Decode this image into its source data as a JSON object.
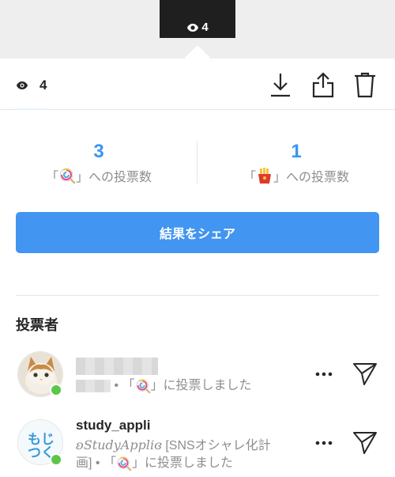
{
  "story_preview": {
    "view_count": "4"
  },
  "toolbar": {
    "view_count": "4",
    "icons": [
      "eye-icon",
      "download-icon",
      "share-icon",
      "trash-icon"
    ]
  },
  "poll_results": {
    "options": [
      {
        "emoji": "lollipop-emoji",
        "count": "3",
        "label_prefix": "「",
        "label_suffix": "」への投票数"
      },
      {
        "emoji": "fries-emoji",
        "count": "1",
        "label_prefix": "「",
        "label_suffix": "」への投票数"
      }
    ]
  },
  "share_button": {
    "label": "結果をシェア",
    "color": "#4295f0"
  },
  "voters_section": {
    "title": "投票者",
    "voters": [
      {
        "name": "",
        "name_hidden": true,
        "subtitle_middle": " • 「",
        "subtitle_suffix": "」に投票しました",
        "vote_emoji": "lollipop-emoji",
        "online": true
      },
      {
        "name": "study_appli",
        "brand_text": "ʚStudyAppliɞ",
        "subtitle_line1_rest": " [SNSオシャレ化計",
        "subtitle_line2_prefix": "画] • 「",
        "subtitle_suffix": "」に投票しました",
        "vote_emoji": "lollipop-emoji",
        "avatar_text": "もじつく",
        "online": true
      }
    ]
  },
  "colors": {
    "accent": "#3897f0",
    "online": "#5cc64b",
    "muted": "#8e8e8e"
  }
}
